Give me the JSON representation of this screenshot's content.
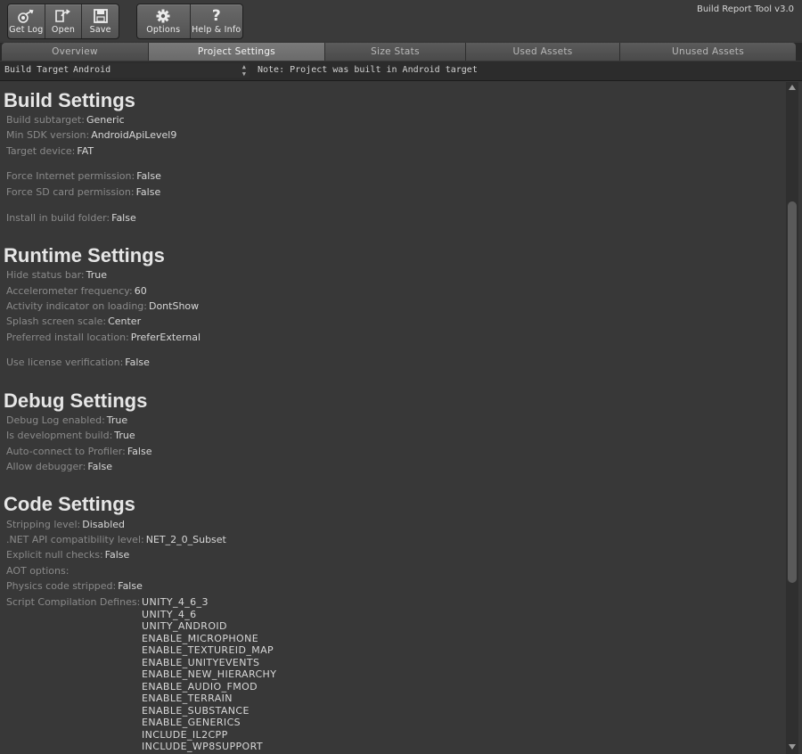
{
  "toolbar": {
    "buttons": [
      {
        "label": "Get Log",
        "icon": "get-log-icon"
      },
      {
        "label": "Open",
        "icon": "open-icon"
      },
      {
        "label": "Save",
        "icon": "save-icon"
      }
    ],
    "buttons2": [
      {
        "label": "Options",
        "icon": "gear-icon"
      },
      {
        "label": "Help & Info",
        "icon": "question-icon",
        "glyph": "?"
      }
    ],
    "version": "Build Report Tool v3.0"
  },
  "tabs": [
    {
      "label": "Overview"
    },
    {
      "label": "Project Settings",
      "active": true
    },
    {
      "label": "Size Stats"
    },
    {
      "label": "Used Assets"
    },
    {
      "label": "Unused Assets"
    }
  ],
  "target": {
    "label": "Build Target:",
    "value": "Android",
    "note": "Note: Project was built in Android target"
  },
  "sections": {
    "build": {
      "title": "Build Settings",
      "rows": [
        {
          "k": "Build subtarget:",
          "v": "Generic"
        },
        {
          "k": "Min SDK version:",
          "v": "AndroidApiLevel9"
        },
        {
          "k": "Target device:",
          "v": "FAT"
        },
        {
          "k": "Force Internet permission:",
          "v": "False"
        },
        {
          "k": "Force SD card permission:",
          "v": "False"
        },
        {
          "k": "Install in build folder:",
          "v": "False"
        }
      ]
    },
    "runtime": {
      "title": "Runtime Settings",
      "rows": [
        {
          "k": "Hide status bar:",
          "v": "True"
        },
        {
          "k": "Accelerometer frequency:",
          "v": "60"
        },
        {
          "k": "Activity indicator on loading:",
          "v": "DontShow"
        },
        {
          "k": "Splash screen scale:",
          "v": "Center"
        },
        {
          "k": "Preferred install location:",
          "v": "PreferExternal"
        },
        {
          "k": "Use license verification:",
          "v": "False"
        }
      ]
    },
    "debug": {
      "title": "Debug Settings",
      "rows": [
        {
          "k": "Debug Log enabled:",
          "v": "True"
        },
        {
          "k": "Is development build:",
          "v": "True"
        },
        {
          "k": "Auto-connect to Profiler:",
          "v": "False"
        },
        {
          "k": "Allow debugger:",
          "v": "False"
        }
      ]
    },
    "code": {
      "title": "Code Settings",
      "rows": [
        {
          "k": "Stripping level:",
          "v": "Disabled"
        },
        {
          "k": ".NET API compatibility level:",
          "v": "NET_2_0_Subset"
        },
        {
          "k": "Explicit null checks:",
          "v": "False"
        },
        {
          "k": "AOT options:",
          "v": ""
        },
        {
          "k": "Physics code stripped:",
          "v": "False"
        },
        {
          "k": "Script Compilation Defines:",
          "v": ""
        }
      ],
      "defines": [
        "UNITY_4_6_3",
        "UNITY_4_6",
        "UNITY_ANDROID",
        "ENABLE_MICROPHONE",
        "ENABLE_TEXTUREID_MAP",
        "ENABLE_UNITYEVENTS",
        "ENABLE_NEW_HIERARCHY",
        "ENABLE_AUDIO_FMOD",
        "ENABLE_TERRAIN",
        "ENABLE_SUBSTANCE",
        "ENABLE_GENERICS",
        "INCLUDE_IL2CPP",
        "INCLUDE_WP8SUPPORT"
      ]
    }
  },
  "colors": {
    "background": "#383838",
    "label": "#8a8a8a",
    "value": "#d8d8d8",
    "heading": "#e6e6e6"
  }
}
